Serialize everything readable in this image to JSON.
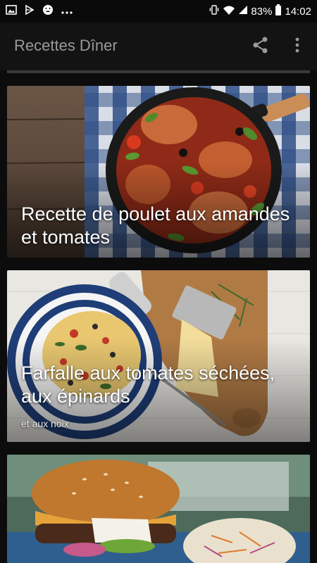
{
  "status_bar": {
    "icons_left": [
      "image-icon",
      "play-store-icon",
      "emoji-icon",
      "more-dots-icon"
    ],
    "battery_percent": "83%",
    "time": "14:02",
    "icons_right": [
      "vibrate-icon",
      "wifi-icon",
      "signal-icon",
      "battery-icon"
    ]
  },
  "app_bar": {
    "title": "Recettes Dîner",
    "actions": [
      "share-icon",
      "more-vert-icon"
    ],
    "background": "#131313",
    "title_color": "#9a9a9a"
  },
  "recipes": [
    {
      "title": "Recette de poulet aux amandes et tomates",
      "subtitle": ""
    },
    {
      "title": "Farfalle aux tomates séchées, aux épinards",
      "subtitle": "et aux noix"
    },
    {
      "title": "",
      "subtitle": ""
    }
  ]
}
